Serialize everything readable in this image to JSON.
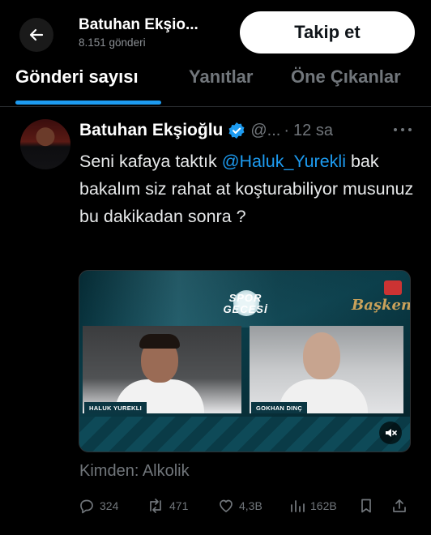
{
  "header": {
    "profile_name": "Batuhan Ekşio...",
    "post_count": "8.151 gönderi",
    "follow_label": "Takip et"
  },
  "tabs": [
    {
      "label": "Gönderi sayısı",
      "active": true
    },
    {
      "label": "Yanıtlar",
      "active": false
    },
    {
      "label": "Öne Çıkanlar",
      "active": false
    }
  ],
  "tweet": {
    "author": "Batuhan Ekşioğlu",
    "verified": true,
    "handle": "@...",
    "time": "12 sa",
    "text_before": "Seni kafaya taktık",
    "mention": "@Haluk_Yurekli",
    "text_after": "bak bakalım siz rahat at koşturabiliyor musunuz bu dakikadan sonra ?",
    "media": {
      "logo_line1": "SPOR",
      "logo_line2": "GECESİ",
      "channel": "Başkent",
      "left_name_tag": "HALUK YUREKLI",
      "right_name_tag": "GOKHAN DINÇ"
    },
    "source": "Kimden: Alkolik",
    "stats": {
      "replies": "324",
      "retweets": "471",
      "likes": "4,3B",
      "views": "162B"
    }
  },
  "colors": {
    "accent": "#1d9bf0",
    "muted": "#71767b",
    "background": "#000000"
  },
  "icons": [
    "back-arrow-icon",
    "verified-badge-icon",
    "more-icon",
    "reply-icon",
    "retweet-icon",
    "like-icon",
    "views-icon",
    "bookmark-icon",
    "share-icon",
    "mute-icon"
  ]
}
